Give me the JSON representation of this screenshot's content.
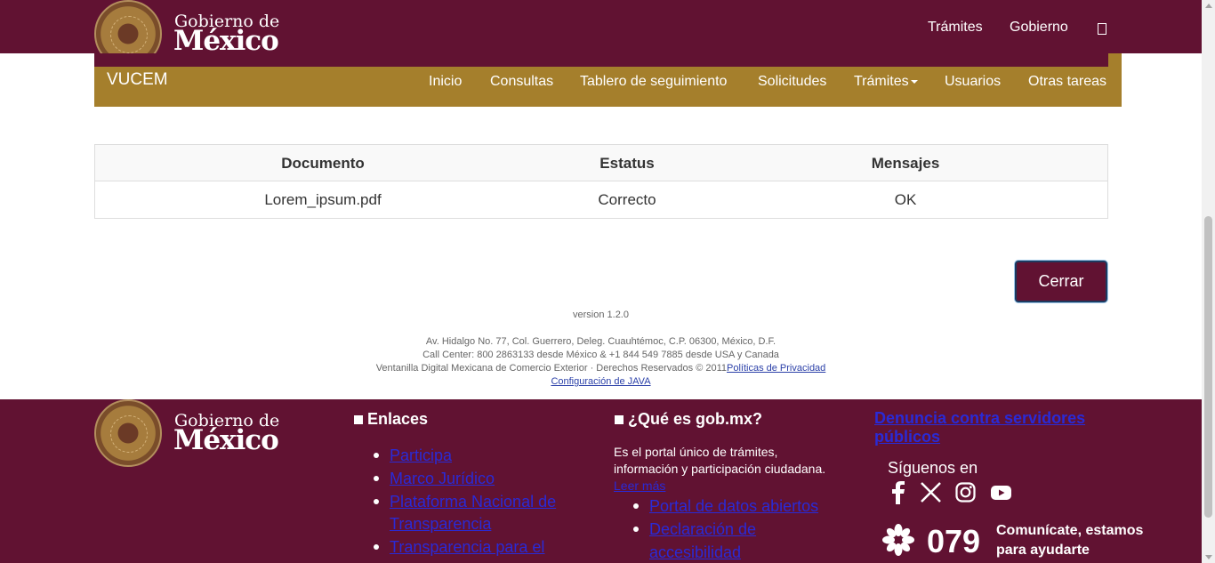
{
  "header": {
    "brand_line1": "Gobierno de",
    "brand_line2": "México",
    "nav": [
      "Trámites",
      "Gobierno"
    ],
    "search_icon": "search-icon"
  },
  "subnav": {
    "title": "VUCEM",
    "items": [
      "Inicio",
      "Consultas",
      "Tablero de seguimiento",
      "Solicitudes",
      "Trámites",
      "Usuarios",
      "Otras tareas"
    ]
  },
  "table": {
    "headers": [
      "Documento",
      "Estatus",
      "Mensajes"
    ],
    "rows": [
      [
        "Lorem_ipsum.pdf",
        "Correcto",
        "OK"
      ]
    ]
  },
  "actions": {
    "close_label": "Cerrar"
  },
  "page_footer": {
    "version": "version 1.2.0",
    "address": "Av. Hidalgo No. 77, Col. Guerrero, Deleg. Cuauhtémoc, C.P. 06300, México, D.F.",
    "call_center": "Call Center: 800 2863133 desde México & +1 844 549 7885 desde USA y Canada",
    "rights": "Ventanilla Digital Mexicana de Comercio Exterior · Derechos Reservados © 2011",
    "privacy_link": "Políticas de Privacidad",
    "java_link": "Configuración de JAVA"
  },
  "footer": {
    "brand_line1": "Gobierno de",
    "brand_line2": "México",
    "links_heading": "Enlaces",
    "links": [
      "Participa",
      "Marco Jurídico",
      "Plataforma Nacional de",
      "Transparencia",
      "Transparencia para el"
    ],
    "about_heading": "¿Qué es gob.mx?",
    "about_text_1": "Es el portal único de trámites,",
    "about_text_2": "información y participación ciudadana.",
    "read_more": "Leer más",
    "about_links": [
      "Portal de datos abiertos",
      "Declaración de",
      "accesibilidad"
    ],
    "report_link_1": "Denuncia contra servidores",
    "report_link_2": "públicos",
    "follow": "Síguenos en",
    "phone": "079",
    "phone_text_1": "Comunícate, estamos",
    "phone_text_2": "para ayudarte",
    "social_icons": [
      "facebook-icon",
      "x-icon",
      "instagram-icon",
      "youtube-icon"
    ]
  },
  "colors": {
    "primary": "#611232",
    "gold": "#a57f2c",
    "link": "#2a2ad6"
  }
}
